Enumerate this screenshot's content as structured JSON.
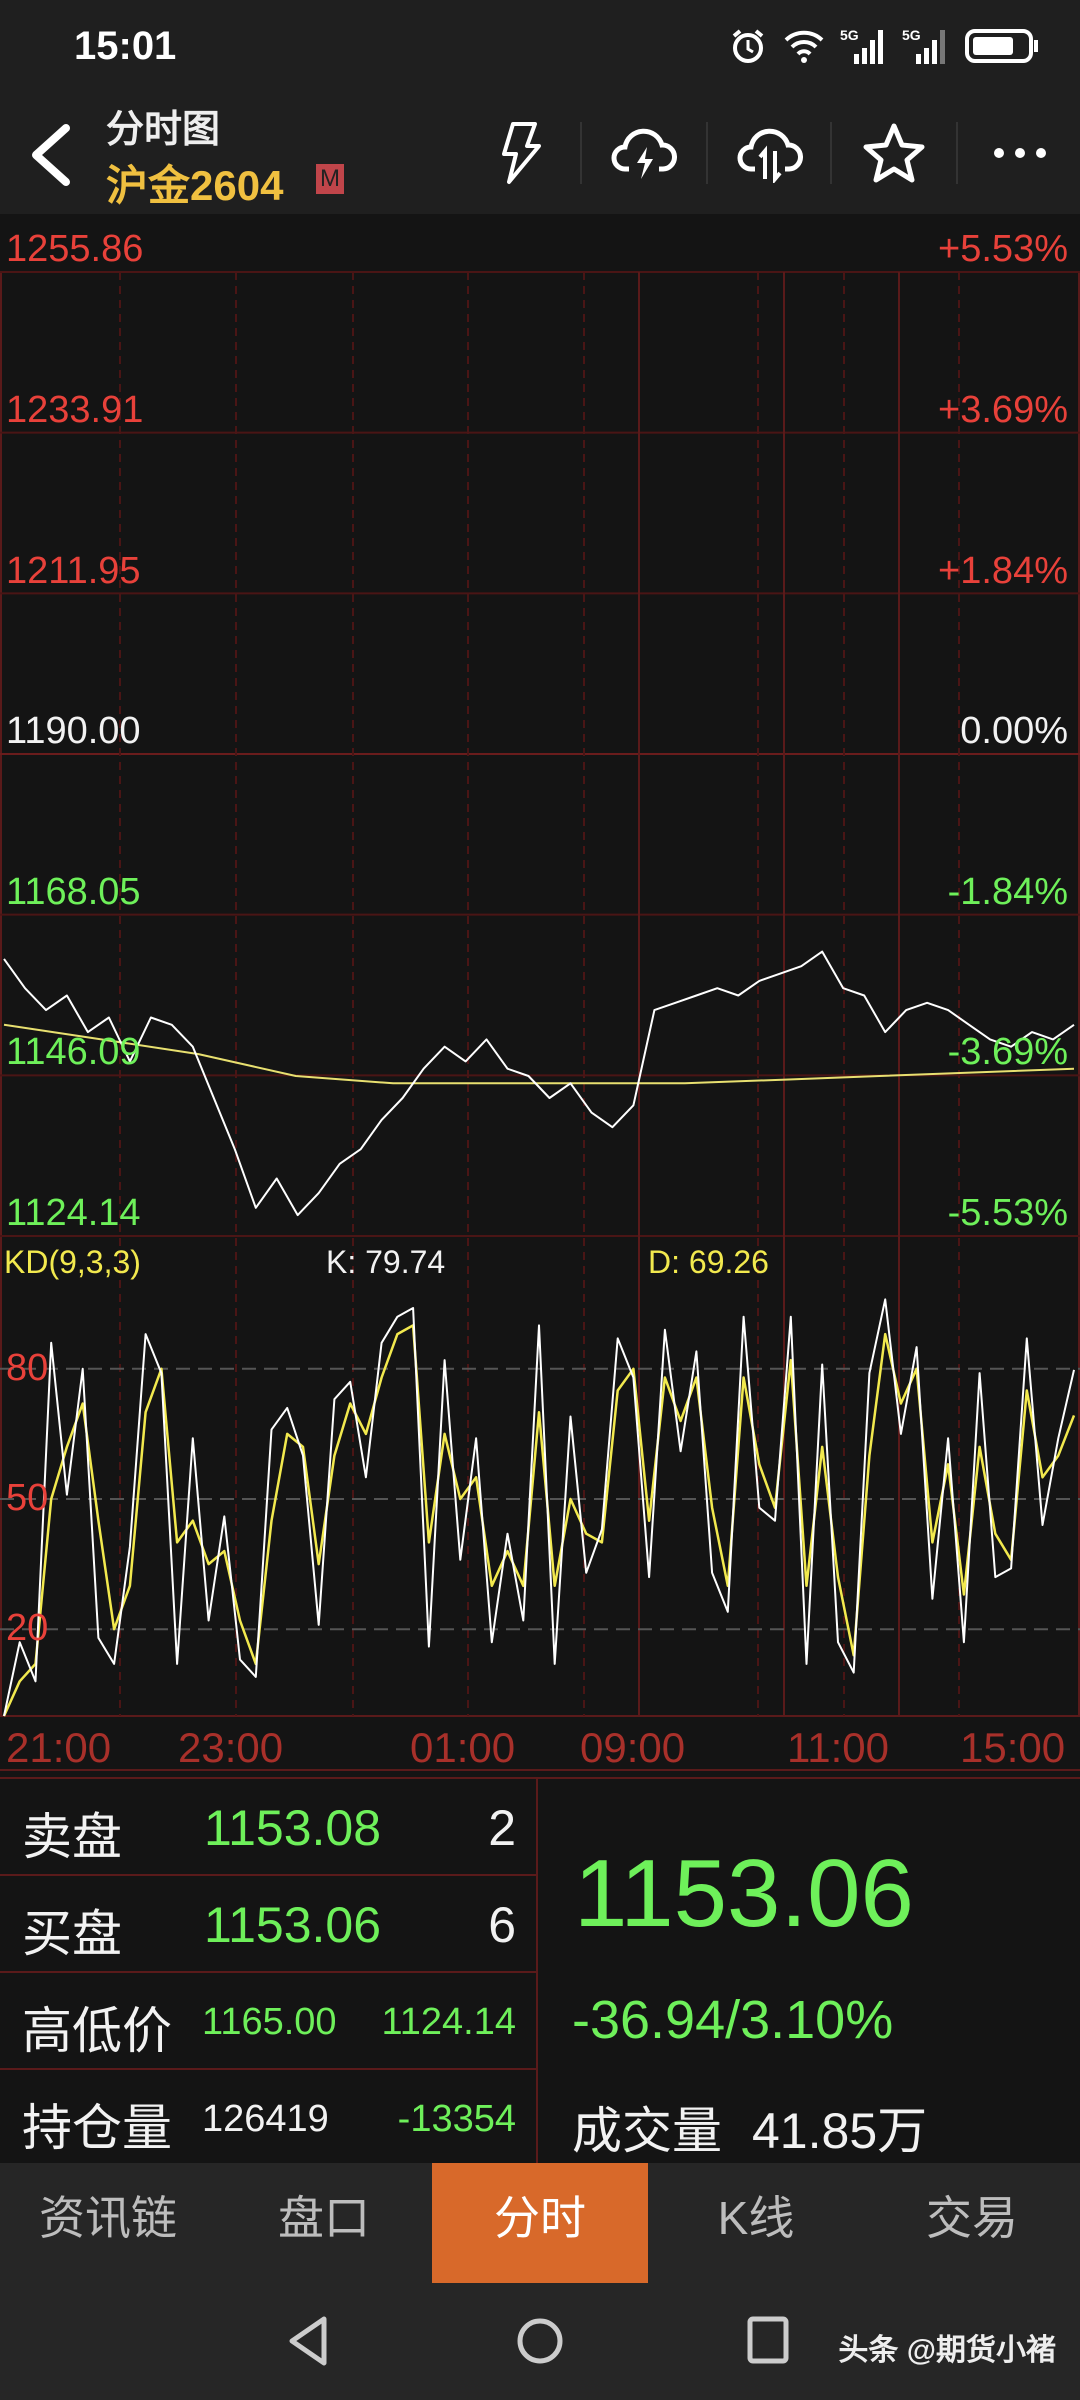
{
  "status": {
    "time": "15:01"
  },
  "header": {
    "subtitle": "分时图",
    "title": "沪金2604",
    "badge": "M"
  },
  "price_axis": {
    "left": [
      "1255.86",
      "1233.91",
      "1211.95",
      "1190.00",
      "1168.05",
      "1146.09",
      "1124.14"
    ],
    "right": [
      "+5.53%",
      "+3.69%",
      "+1.84%",
      "0.00%",
      "-1.84%",
      "-3.69%",
      "-5.53%"
    ]
  },
  "kd": {
    "name": "KD(9,3,3)",
    "k_label": "K: 79.74",
    "d_label": "D: 69.26",
    "ticks": [
      "80",
      "50",
      "20"
    ]
  },
  "time_axis": [
    "21:00",
    "23:00",
    "01:00",
    "09:00",
    "11:00",
    "15:00"
  ],
  "colors": {
    "up": "#e8413a",
    "down": "#6ef05a",
    "accent": "#d8692a",
    "price_line": "#ffffff",
    "avg_line": "#e8e070"
  },
  "chart_data": [
    {
      "type": "line",
      "title": "分时图",
      "ylim": [
        1124.14,
        1255.86
      ],
      "series": [
        {
          "name": "price",
          "values": [
            1162,
            1158,
            1155,
            1157,
            1152,
            1154,
            1148,
            1154,
            1153,
            1150,
            1143,
            1136,
            1128,
            1132,
            1127,
            1130,
            1134,
            1136,
            1140,
            1143,
            1147,
            1150,
            1148,
            1151,
            1147,
            1146,
            1143,
            1145,
            1141,
            1139,
            1142,
            1155,
            1156,
            1157,
            1158,
            1157,
            1159,
            1160,
            1161,
            1163,
            1158,
            1157,
            1152,
            1155,
            1156,
            1155,
            1153,
            1151,
            1150,
            1152,
            1151,
            1153
          ]
        },
        {
          "name": "average",
          "values": [
            1153,
            1151,
            1149,
            1146,
            1145,
            1145,
            1145,
            1145,
            1145.5,
            1146,
            1146.5,
            1147
          ]
        }
      ]
    },
    {
      "type": "line",
      "title": "KD(9,3,3)",
      "ylim": [
        0,
        100
      ],
      "series": [
        {
          "name": "K",
          "values": [
            0,
            17,
            8,
            86,
            51,
            80,
            18,
            12,
            39,
            88,
            79,
            12,
            64,
            22,
            46,
            13,
            9,
            66,
            71,
            60,
            21,
            73,
            77,
            55,
            86,
            92,
            94,
            16,
            82,
            36,
            64,
            17,
            42,
            22,
            90,
            12,
            69,
            33,
            43,
            87,
            78,
            32,
            89,
            61,
            84,
            33,
            24,
            92,
            48,
            45,
            92,
            12,
            81,
            17,
            10,
            79,
            96,
            65,
            85,
            27,
            64,
            17,
            79,
            32,
            34,
            87,
            44,
            64,
            79.74
          ]
        },
        {
          "name": "D",
          "values": [
            0,
            8,
            12,
            50,
            62,
            72,
            45,
            20,
            30,
            70,
            80,
            40,
            45,
            35,
            38,
            22,
            12,
            45,
            65,
            62,
            35,
            60,
            72,
            65,
            78,
            88,
            90,
            40,
            65,
            50,
            55,
            30,
            38,
            30,
            70,
            30,
            50,
            42,
            40,
            75,
            80,
            45,
            78,
            68,
            78,
            48,
            30,
            78,
            58,
            48,
            82,
            30,
            62,
            32,
            14,
            60,
            88,
            72,
            80,
            40,
            58,
            28,
            62,
            42,
            36,
            75,
            55,
            60,
            69.26
          ]
        }
      ]
    }
  ],
  "quote": {
    "ask_label": "卖盘",
    "ask_price": "1153.08",
    "ask_vol": "2",
    "bid_label": "买盘",
    "bid_price": "1153.06",
    "bid_vol": "6",
    "hl_label": "高低价",
    "high": "1165.00",
    "low": "1124.14",
    "oi_label": "持仓量",
    "oi": "126419",
    "oi_change": "-13354",
    "last": "1153.06",
    "change": "-36.94/3.10%",
    "volume_label": "成交量",
    "volume": "41.85万"
  },
  "tabs": [
    {
      "label": "资讯链"
    },
    {
      "label": "盘口"
    },
    {
      "label": "分时",
      "active": true
    },
    {
      "label": "K线"
    },
    {
      "label": "交易"
    }
  ],
  "watermark": "头条 @期货小褚"
}
